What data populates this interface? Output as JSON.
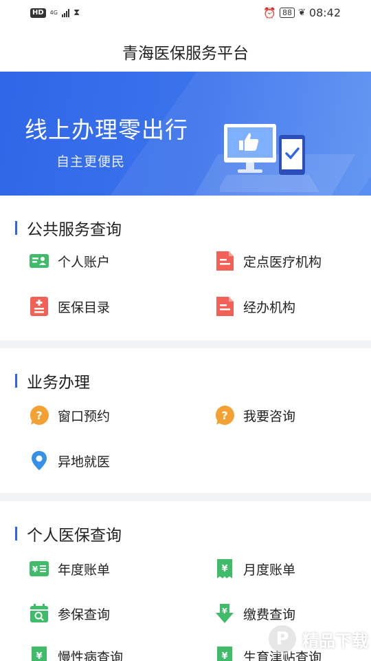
{
  "status_bar": {
    "hd": "HD",
    "network": "4G",
    "time": "08:42",
    "battery": "88",
    "alarm_icon": "alarm-clock-icon",
    "leaf_icon": "leaf-icon",
    "hourglass_icon": "hourglass-icon"
  },
  "header": {
    "title": "青海医保服务平台"
  },
  "banner": {
    "title": "线上办理零出行",
    "subtitle": "自主更便民",
    "illustration": "monitor-thumbs-up-phone-check"
  },
  "colors": {
    "accent": "#2f66e8",
    "green": "#3fbb6a",
    "red": "#f26158",
    "orange": "#f4a133",
    "blue": "#3591e8",
    "divider": "#f2f3f5"
  },
  "sections": [
    {
      "title": "公共服务查询",
      "items": [
        {
          "label": "个人账户",
          "icon": "id-card-icon"
        },
        {
          "label": "定点医疗机构",
          "icon": "document-icon"
        },
        {
          "label": "医保目录",
          "icon": "medical-list-icon"
        },
        {
          "label": "经办机构",
          "icon": "document-icon"
        }
      ]
    },
    {
      "title": "业务办理",
      "items": [
        {
          "label": "窗口预约",
          "icon": "question-bubble-icon"
        },
        {
          "label": "我要咨询",
          "icon": "question-bubble-icon"
        },
        {
          "label": "异地就医",
          "icon": "location-pin-icon"
        }
      ]
    },
    {
      "title": "个人医保查询",
      "items": [
        {
          "label": "年度账单",
          "icon": "yuan-bill-icon"
        },
        {
          "label": "月度账单",
          "icon": "yuan-receipt-icon"
        },
        {
          "label": "参保查询",
          "icon": "calendar-search-icon"
        },
        {
          "label": "缴费查询",
          "icon": "yuan-down-arrow-icon"
        },
        {
          "label": "慢性病查询",
          "icon": "yuan-receipt-icon"
        },
        {
          "label": "生育津贴查询",
          "icon": "yuan-receipt-icon"
        }
      ]
    }
  ],
  "watermark": {
    "text": "精品下载",
    "logo": "P"
  }
}
